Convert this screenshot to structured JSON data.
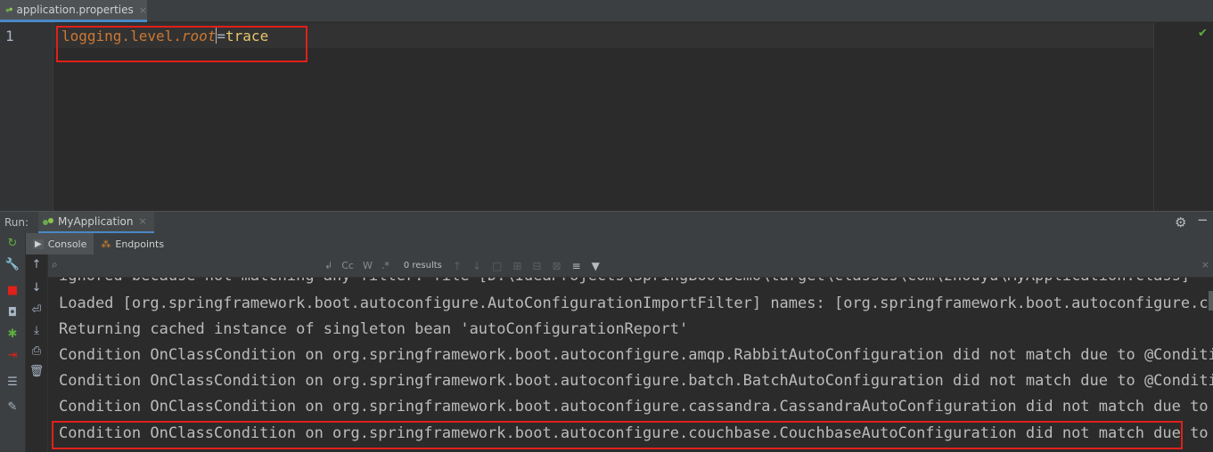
{
  "editor_tab": {
    "label": "application.properties",
    "close": "×"
  },
  "editor": {
    "line_number": "1",
    "code": {
      "key1": "logging.level.",
      "key2": "root",
      "eq": "=",
      "value": "trace"
    }
  },
  "run_panel": {
    "title": "Run:",
    "tab_label": "MyApplication",
    "tab_close": "×",
    "subtabs": [
      {
        "label": "Console"
      },
      {
        "label": "Endpoints"
      }
    ],
    "search": {
      "placeholder": "",
      "case_option": "Cc",
      "word_option": "W",
      "regex_option": ".*",
      "results": "0 results"
    },
    "console_lines": [
      "ignored because not matching any filter: file [D:\\IdeaProjects\\SpringBootDemo\\target\\classes\\com\\zhouyu\\MyApplication.class]",
      "Loaded [org.springframework.boot.autoconfigure.AutoConfigurationImportFilter] names: [org.springframework.boot.autoconfigure.co",
      "Returning cached instance of singleton bean 'autoConfigurationReport'",
      "Condition OnClassCondition on org.springframework.boot.autoconfigure.amqp.RabbitAutoConfiguration did not match due to @Conditi",
      "Condition OnClassCondition on org.springframework.boot.autoconfigure.batch.BatchAutoConfiguration did not match due to @Conditi",
      "Condition OnClassCondition on org.springframework.boot.autoconfigure.cassandra.CassandraAutoConfiguration did not match due to",
      "Condition OnClassCondition on org.springframework.boot.autoconfigure.couchbase.CouchbaseAutoConfiguration did not match due to"
    ]
  },
  "colors": {
    "highlight_border": "#e0201a",
    "accent": "#4a88c7",
    "check": "#5ead3f"
  }
}
